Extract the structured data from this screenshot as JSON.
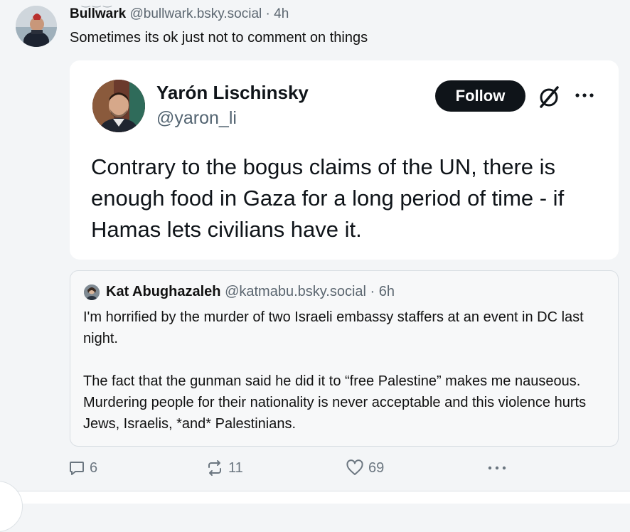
{
  "post": {
    "author_name": "Bullwark",
    "author_handle": "@bullwark.bsky.social",
    "separator": "·",
    "time": "4h",
    "text": "Sometimes its ok just not to comment on things"
  },
  "embedded_tweet": {
    "name": "Yarón Lischinsky",
    "handle": "@yaron_li",
    "follow_label": "Follow",
    "text": "Contrary to the bogus claims of the UN, there is enough food in Gaza for a long period of time - if Hamas lets civilians have it."
  },
  "quote": {
    "author_name": "Kat Abughazaleh",
    "author_handle": "@katmabu.bsky.social",
    "separator": "·",
    "time": "6h",
    "paragraph_1": "I'm horrified by the murder of two Israeli embassy staffers at an event in DC last night.",
    "paragraph_2": "The fact that the gunman said he did it to “free Palestine” makes me nauseous. Murdering people for their nationality is never acceptable and this violence hurts Jews, Israelis, *and* Palestinians."
  },
  "actions": {
    "replies": "6",
    "reposts": "11",
    "likes": "69"
  },
  "icons": [
    "reply-icon",
    "repost-icon",
    "like-icon",
    "more-icon",
    "x-logo-icon",
    "tweet-more-icon"
  ],
  "colors": {
    "background": "#f3f5f7",
    "follow_button": "#0f1419",
    "muted_text": "#5b6670"
  }
}
